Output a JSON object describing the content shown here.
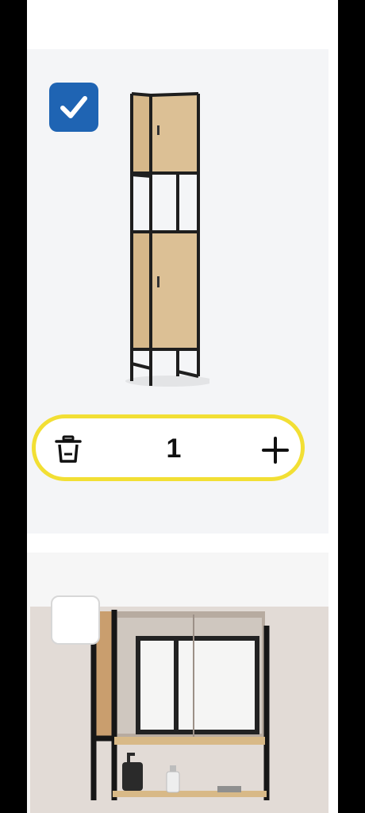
{
  "cart": {
    "items": [
      {
        "image": "wooden-tall-cabinet-photo",
        "selected": true,
        "quantity": "1",
        "icons": {
          "checkbox": "checkmark-icon",
          "delete": "trash-icon",
          "add": "plus-icon"
        },
        "colors": {
          "checkbox": "#1f64b3",
          "stepper_border": "#f2df34"
        }
      },
      {
        "image": "mirror-cabinet-photo",
        "selected": false
      }
    ]
  }
}
